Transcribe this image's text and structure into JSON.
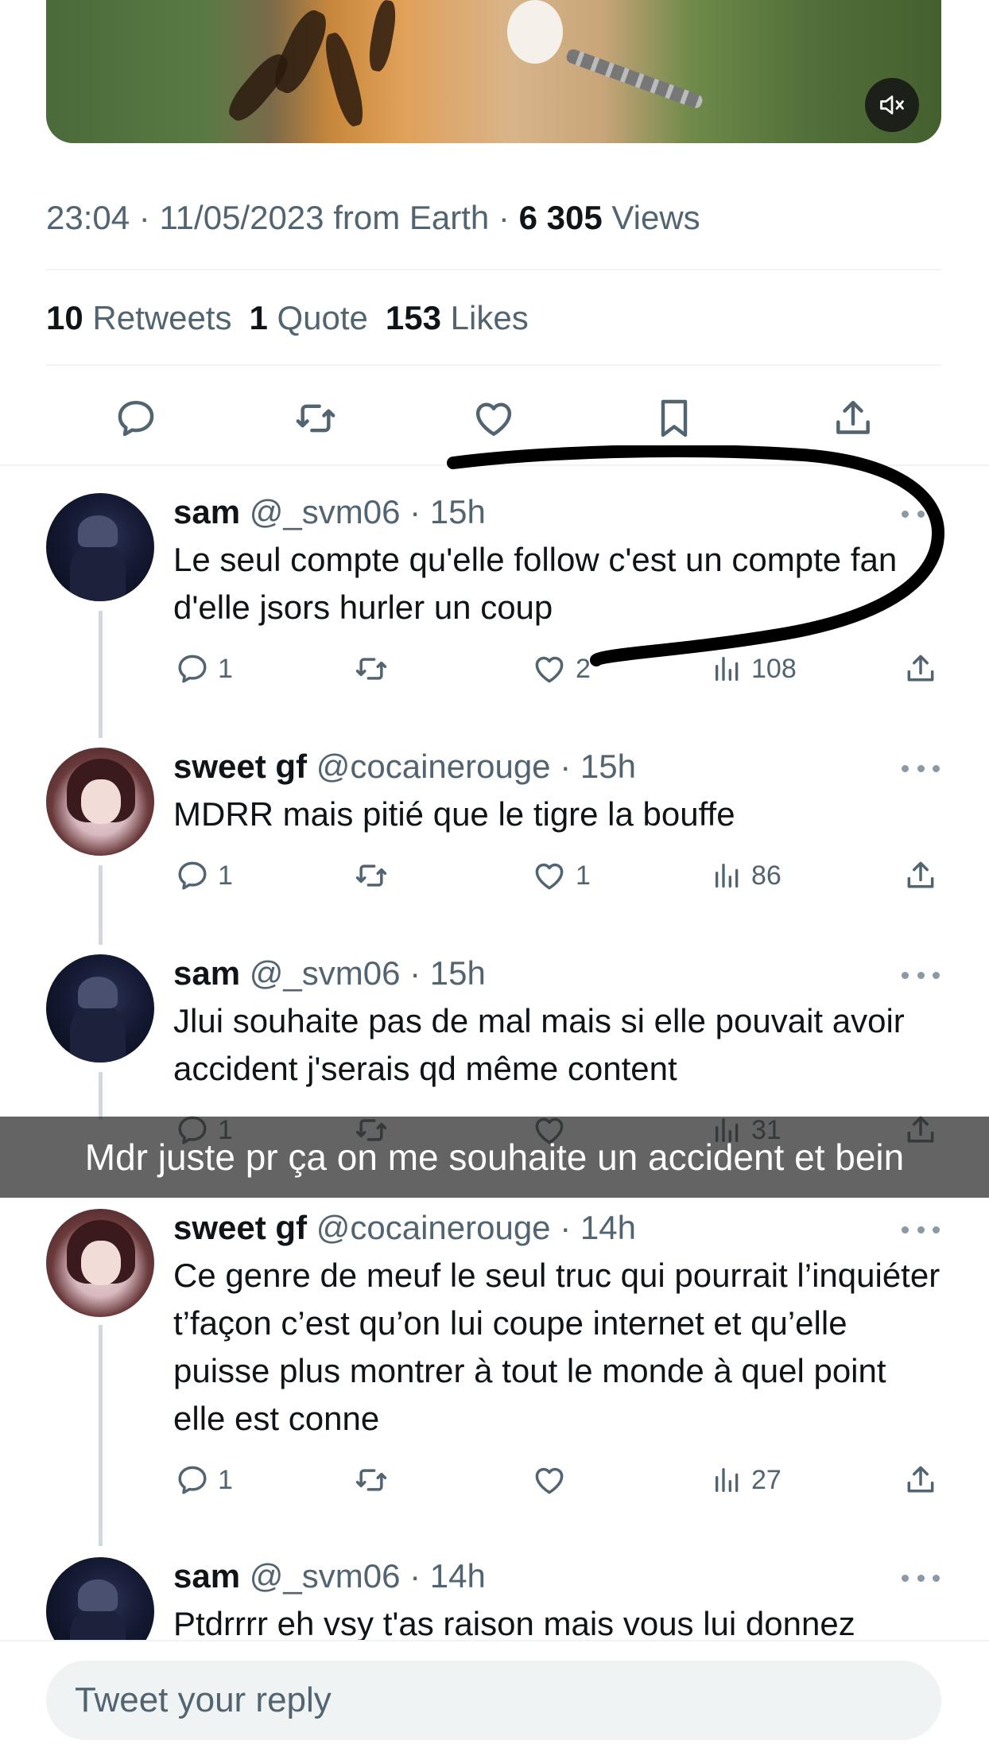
{
  "tweet_meta": {
    "time": "23:04",
    "date": "11/05/2023",
    "source": "from Earth",
    "views_count": "6 305",
    "views_label": "Views"
  },
  "stats": {
    "retweets_count": "10",
    "retweets_label": "Retweets",
    "quotes_count": "1",
    "quotes_label": "Quote",
    "likes_count": "153",
    "likes_label": "Likes"
  },
  "replies": [
    {
      "name": "sam",
      "handle": "@_svm06",
      "time": "15h",
      "avatar": "sam",
      "text": "Le seul compte qu'elle follow c'est un compte fan d'elle jsors hurler un coup",
      "replies": "1",
      "retweets": "",
      "likes": "2",
      "views": "108"
    },
    {
      "name": "sweet gf",
      "handle": "@cocainerouge",
      "time": "15h",
      "avatar": "gf",
      "text": "MDRR mais pitié que le tigre la bouffe",
      "replies": "1",
      "retweets": "",
      "likes": "1",
      "views": "86"
    },
    {
      "name": "sam",
      "handle": "@_svm06",
      "time": "15h",
      "avatar": "sam",
      "text": "Jlui souhaite pas de mal mais si elle pouvait avoir accident j'serais qd même content",
      "replies": "1",
      "retweets": "",
      "likes": "",
      "views": "31"
    },
    {
      "name": "sweet gf",
      "handle": "@cocainerouge",
      "time": "14h",
      "avatar": "gf",
      "text": "Ce genre de meuf le seul truc qui pourrait l’inquiéter t’façon c’est qu’on lui coupe internet et qu’elle puisse plus montrer à tout le monde à quel point elle est conne",
      "replies": "1",
      "retweets": "",
      "likes": "",
      "views": "27"
    },
    {
      "name": "sam",
      "handle": "@_svm06",
      "time": "14h",
      "avatar": "sam",
      "text": "Ptdrrrr eh vsy t'as raison mais vous lui donnez"
    }
  ],
  "snap_caption": "Mdr juste pr ça on me souhaite un accident et bein",
  "reply_bar": {
    "placeholder": "Tweet your reply"
  },
  "colors": {
    "text": "#0f1419",
    "secondary": "#536471",
    "divider": "#eff3f4",
    "thread": "#cfd9de"
  },
  "icons": [
    "mute-icon",
    "reply-icon",
    "retweet-icon",
    "like-icon",
    "bookmark-icon",
    "share-icon",
    "views-icon",
    "more-icon"
  ]
}
